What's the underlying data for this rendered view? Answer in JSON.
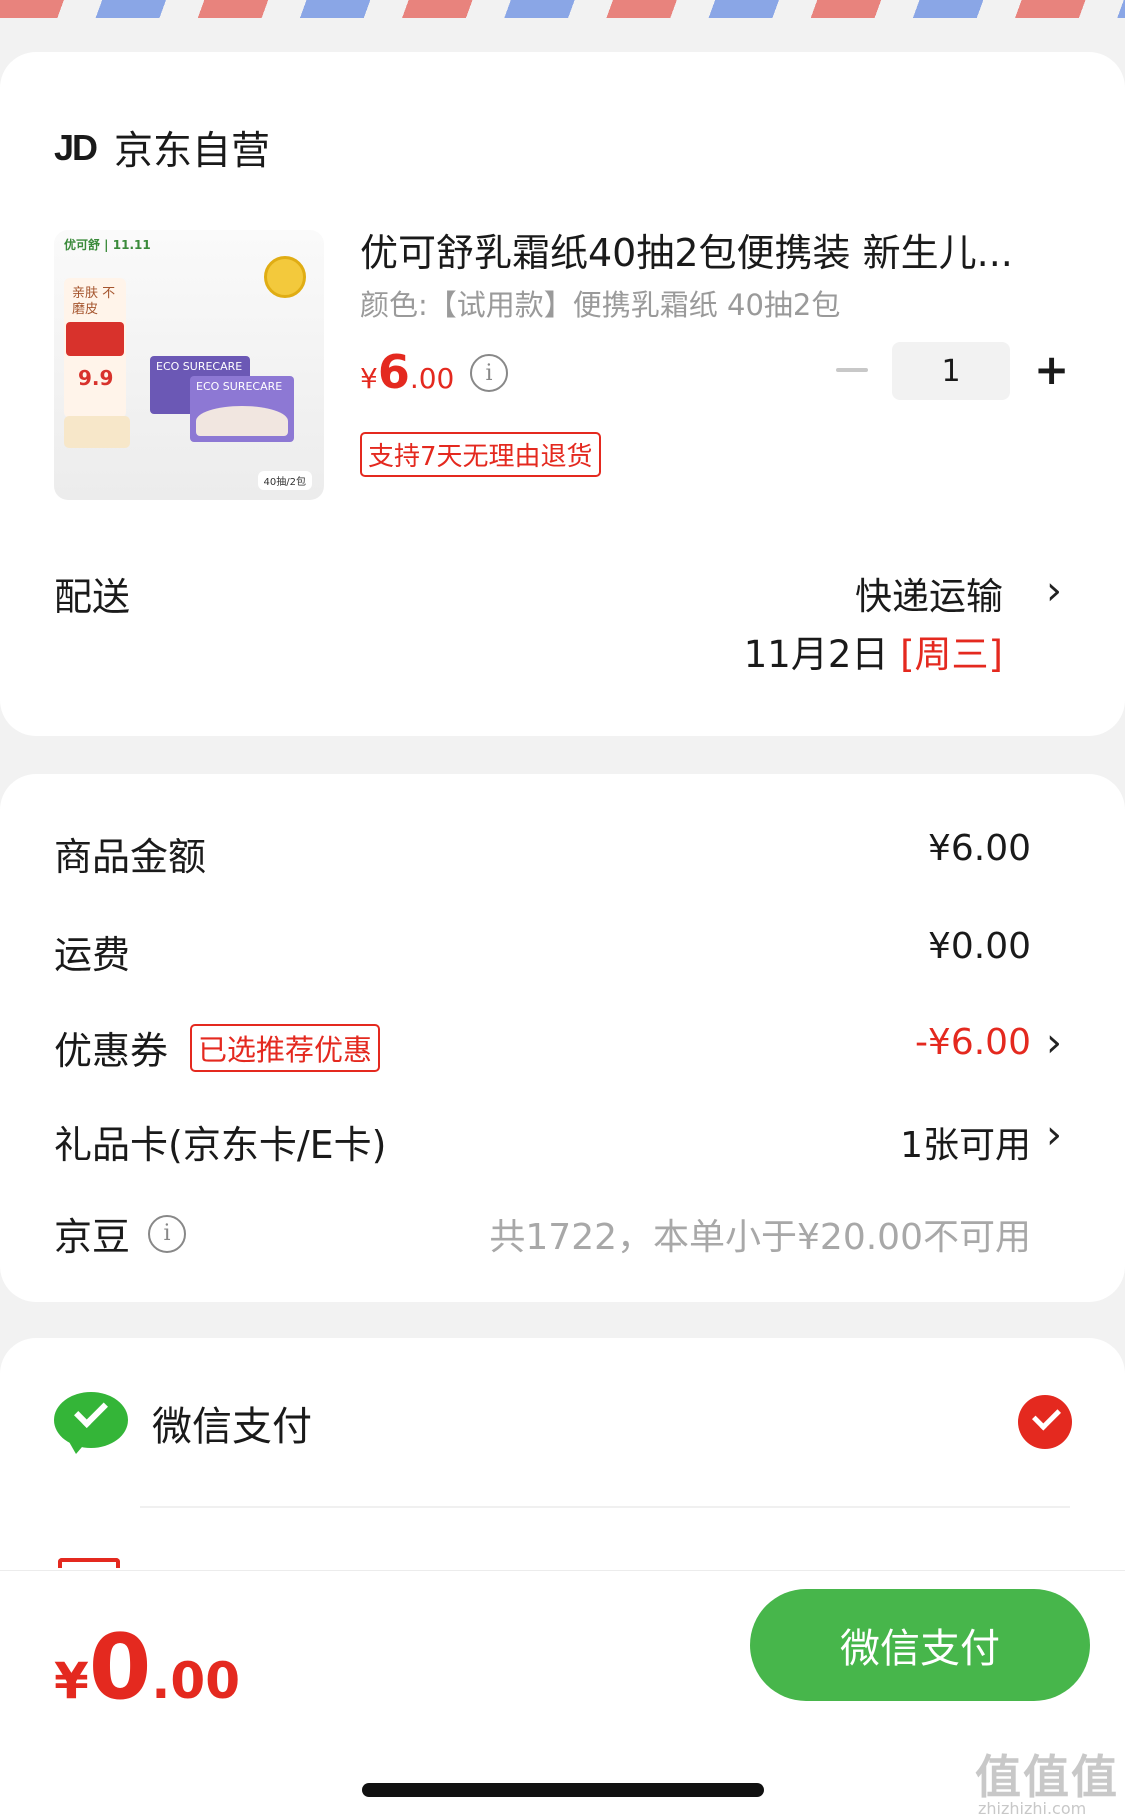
{
  "shop": {
    "logo": "JD",
    "name": "京东自营"
  },
  "product": {
    "image_texts": {
      "brand": "优可舒 | 11.11",
      "tag": "亲肤 不磨皮",
      "price": "9.9",
      "box": "ECO SURECARE",
      "count": "40抽/2包"
    },
    "title": "优可舒乳霜纸40抽2包便携装 新生儿...",
    "spec": "颜色:【试用款】便携乳霜纸 40抽2包",
    "price_symbol": "¥",
    "price_int": "6",
    "price_dec": ".00",
    "quantity": "1",
    "minus": "−",
    "plus": "+",
    "return_policy": "支持7天无理由退货"
  },
  "delivery": {
    "label": "配送",
    "method": "快递运输",
    "date": "11月2日",
    "weekday": "[周三]"
  },
  "costs": {
    "goods_label": "商品金额",
    "goods_value": "¥6.00",
    "shipping_label": "运费",
    "shipping_value": "¥0.00",
    "coupon_label": "优惠券",
    "coupon_tag": "已选推荐优惠",
    "coupon_value": "-¥6.00",
    "giftcard_label": "礼品卡(京东卡/E卡)",
    "giftcard_value": "1张可用",
    "jingdou_label": "京豆",
    "jingdou_value": "共1722，本单小于¥20.00不可用"
  },
  "payment": {
    "method": "微信支付"
  },
  "footer": {
    "total_symbol": "¥",
    "total_int": "0",
    "total_dec": ".00",
    "pay_button": "微信支付",
    "watermark": "值值值",
    "watermark_url": "zhizhizhi.com"
  },
  "colors": {
    "accent_red": "#e4291f",
    "wechat_green": "#47b64b",
    "background": "#f2f2f2"
  }
}
